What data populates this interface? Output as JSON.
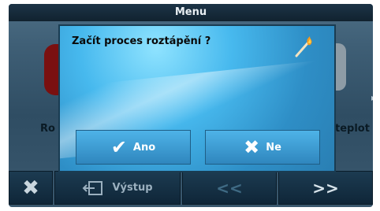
{
  "window": {
    "title": "Menu"
  },
  "background": {
    "left_label": "Ro",
    "right_label": "teplot"
  },
  "bottom": {
    "close_icon": "close-x-icon",
    "exit_label": "Výstup",
    "prev_label": "<<",
    "next_label": ">>"
  },
  "dialog": {
    "question": "Začít proces roztápění ?",
    "icon": "match-flame-icon",
    "buttons": [
      {
        "label": "Ano",
        "icon": "checkmark-icon"
      },
      {
        "label": "Ne",
        "icon": "x-icon"
      }
    ]
  }
}
